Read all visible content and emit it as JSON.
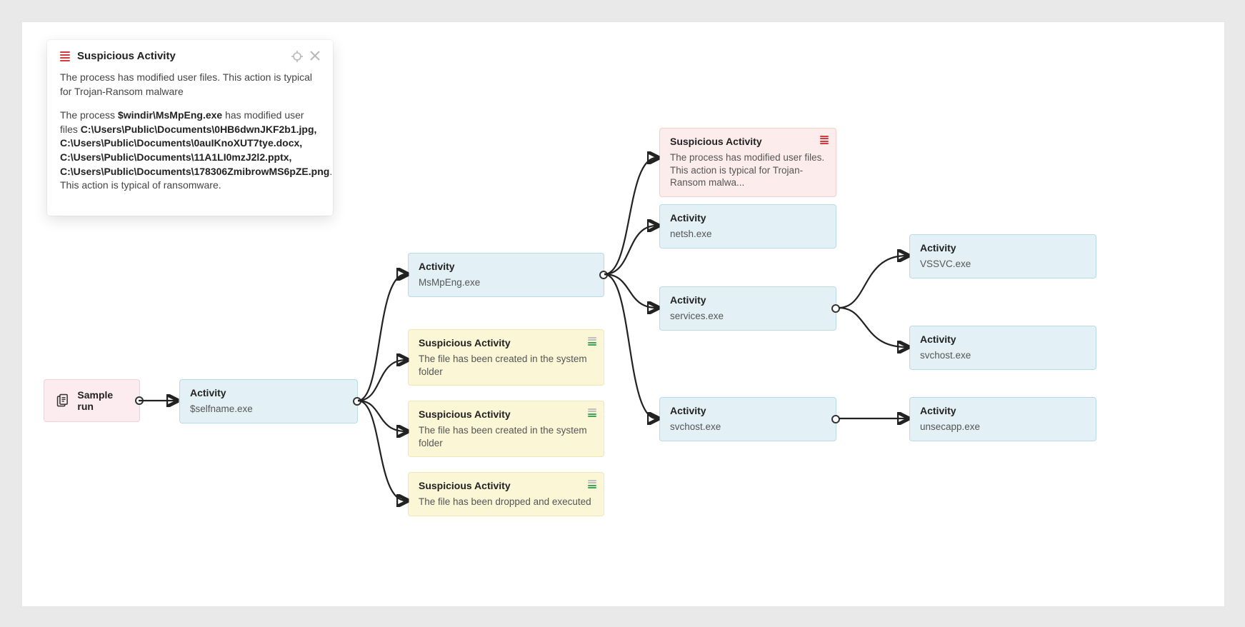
{
  "popup": {
    "title": "Suspicious Activity",
    "summary": "The process has modified user files. This action is typical for Trojan-Ransom malware",
    "detail_prefix": "The process ",
    "detail_process": "$windir\\MsMpEng.exe",
    "detail_mid": " has modified user files ",
    "detail_files": "C:\\Users\\Public\\Documents\\0HB6dwnJKF2b1.jpg, C:\\Users\\Public\\Documents\\0auIKnoXUT7tye.docx, C:\\Users\\Public\\Documents\\11A1LI0mzJ2l2.pptx, C:\\Users\\Public\\Documents\\178306ZmibrowMS6pZE.png",
    "detail_suffix": ". This action is typical of ransomware."
  },
  "nodes": {
    "root": {
      "label": "Sample run"
    },
    "n1": {
      "title": "Activity",
      "desc": "$selfname.exe"
    },
    "n2": {
      "title": "Activity",
      "desc": "MsMpEng.exe"
    },
    "ny1": {
      "title": "Suspicious Activity",
      "desc": "The file has been created in the system folder"
    },
    "ny2": {
      "title": "Suspicious Activity",
      "desc": "The file has been created in the system folder"
    },
    "ny3": {
      "title": "Suspicious Activity",
      "desc": "The file has been dropped and executed"
    },
    "nr": {
      "title": "Suspicious Activity",
      "desc": "The process has modified user files. This action is typical for Trojan-Ransom malwa..."
    },
    "n_netsh": {
      "title": "Activity",
      "desc": "netsh.exe"
    },
    "n_serv": {
      "title": "Activity",
      "desc": "services.exe"
    },
    "n_svc": {
      "title": "Activity",
      "desc": "svchost.exe"
    },
    "n_vss": {
      "title": "Activity",
      "desc": "VSSVC.exe"
    },
    "n_sh": {
      "title": "Activity",
      "desc": "svchost.exe"
    },
    "n_uns": {
      "title": "Activity",
      "desc": "unsecapp.exe"
    }
  }
}
